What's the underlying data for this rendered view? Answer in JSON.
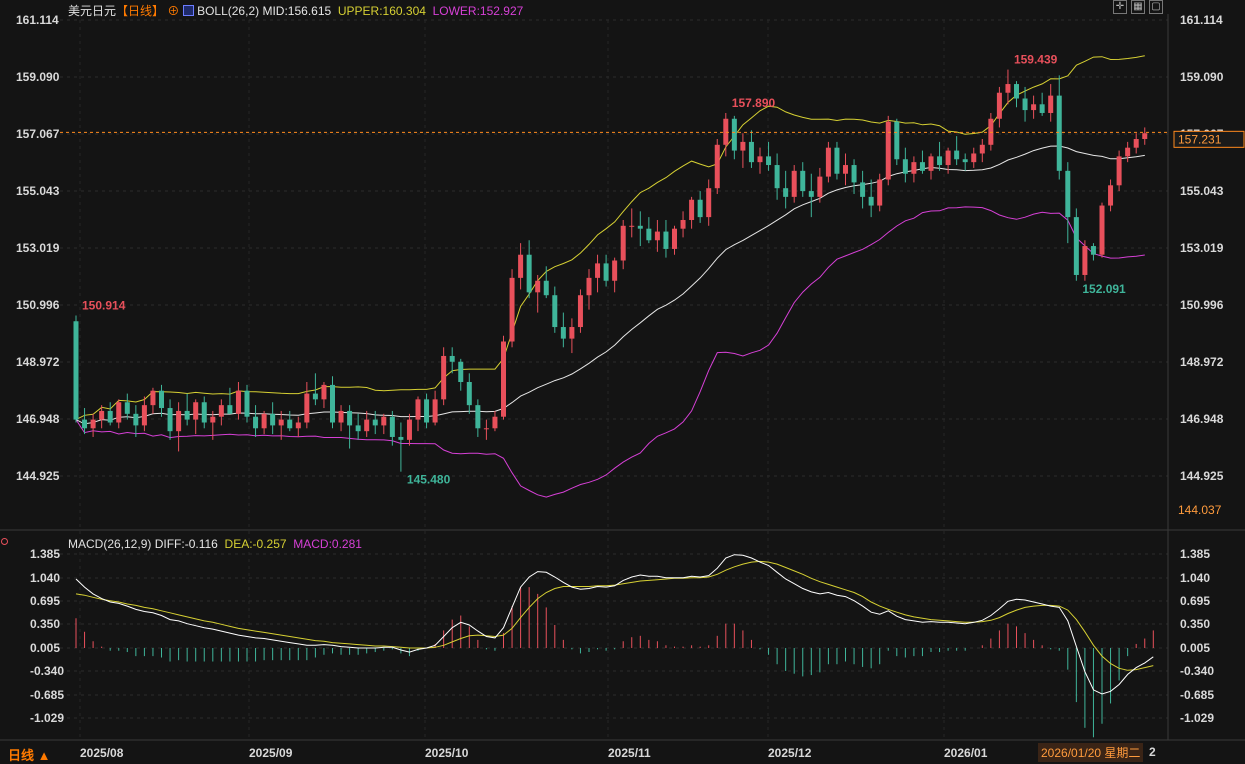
{
  "header": {
    "title": "美元日元",
    "period_tag": "【日线】",
    "boll_label": "BOLL(26,2)",
    "mid": "MID:156.615",
    "upper": "UPPER:160.304",
    "lower": "LOWER:152.927"
  },
  "macd_header": {
    "label": "MACD(26,12,9)",
    "diff": "DIFF:-0.116",
    "dea": "DEA:-0.257",
    "macd": "MACD:0.281"
  },
  "footer": {
    "period": "日线 ▲",
    "timestamp": "2026/01/20 星期二",
    "timestamp_tail": "2"
  },
  "price_axis": {
    "ticks": [
      "161.114",
      "159.090",
      "157.067",
      "155.043",
      "153.019",
      "150.996",
      "148.972",
      "146.948",
      "144.925"
    ],
    "current_price": "157.231",
    "low_marker": "144.037"
  },
  "macd_axis": {
    "ticks": [
      "1.385",
      "1.040",
      "0.695",
      "0.350",
      "0.005",
      "-0.340",
      "-0.685",
      "-1.029"
    ]
  },
  "colors": {
    "up": "#e8505b",
    "down": "#3fb59a",
    "mid": "#e6e6e6",
    "upper": "#d6d033",
    "lower": "#d640d6",
    "dea": "#d6d033",
    "diff": "#ffffff"
  },
  "chart_data": [
    {
      "type": "candlestick",
      "xlabel": "",
      "ylabel": "",
      "ylim": [
        144.037,
        161.114
      ],
      "x_tick_labels": [
        "2025/08",
        "2025/09",
        "2025/10",
        "2025/11",
        "2025/12",
        "2026/01"
      ],
      "annotations": [
        {
          "text": "150.914",
          "kind": "high"
        },
        {
          "text": "145.480",
          "kind": "low"
        },
        {
          "text": "157.890",
          "kind": "high"
        },
        {
          "text": "159.439",
          "kind": "high"
        },
        {
          "text": "152.091",
          "kind": "low"
        }
      ],
      "ohlc": [
        [
          150.7,
          150.9,
          147.2,
          147.3
        ],
        [
          147.3,
          147.7,
          146.8,
          147.0
        ],
        [
          147.0,
          147.5,
          146.7,
          147.3
        ],
        [
          147.3,
          147.8,
          147.0,
          147.6
        ],
        [
          147.6,
          147.9,
          147.1,
          147.2
        ],
        [
          147.2,
          148.0,
          147.0,
          147.9
        ],
        [
          147.9,
          148.2,
          147.3,
          147.5
        ],
        [
          147.5,
          147.8,
          146.7,
          147.1
        ],
        [
          147.1,
          148.1,
          146.9,
          147.8
        ],
        [
          147.8,
          148.4,
          147.5,
          148.3
        ],
        [
          148.3,
          148.5,
          147.4,
          147.7
        ],
        [
          147.7,
          148.0,
          146.6,
          146.9
        ],
        [
          146.9,
          147.9,
          146.2,
          147.6
        ],
        [
          147.6,
          148.2,
          147.1,
          147.3
        ],
        [
          147.3,
          148.0,
          146.8,
          147.9
        ],
        [
          147.9,
          148.1,
          147.0,
          147.2
        ],
        [
          147.2,
          147.6,
          146.6,
          147.4
        ],
        [
          147.4,
          148.0,
          147.1,
          147.8
        ],
        [
          147.8,
          148.4,
          147.5,
          147.5
        ],
        [
          147.5,
          148.6,
          147.3,
          148.3
        ],
        [
          148.3,
          148.5,
          147.2,
          147.4
        ],
        [
          147.4,
          147.8,
          146.7,
          147.0
        ],
        [
          147.0,
          147.6,
          146.8,
          147.5
        ],
        [
          147.5,
          147.9,
          146.8,
          147.1
        ],
        [
          147.1,
          147.6,
          146.6,
          147.3
        ],
        [
          147.3,
          147.6,
          146.9,
          147.0
        ],
        [
          147.0,
          147.4,
          146.7,
          147.2
        ],
        [
          147.2,
          148.6,
          147.0,
          148.2
        ],
        [
          148.2,
          148.9,
          147.8,
          148.0
        ],
        [
          148.0,
          148.6,
          147.7,
          148.5
        ],
        [
          148.5,
          148.8,
          147.0,
          147.2
        ],
        [
          147.2,
          147.8,
          146.9,
          147.6
        ],
        [
          147.6,
          147.8,
          146.3,
          147.1
        ],
        [
          147.1,
          147.5,
          146.6,
          146.9
        ],
        [
          146.9,
          147.6,
          146.7,
          147.3
        ],
        [
          147.3,
          147.6,
          146.8,
          147.1
        ],
        [
          147.1,
          147.5,
          146.8,
          147.4
        ],
        [
          147.4,
          147.6,
          146.4,
          146.7
        ],
        [
          146.7,
          147.2,
          145.5,
          146.6
        ],
        [
          146.6,
          147.5,
          146.4,
          147.3
        ],
        [
          147.3,
          148.1,
          146.9,
          148.0
        ],
        [
          148.0,
          148.2,
          147.0,
          147.2
        ],
        [
          147.2,
          148.3,
          147.1,
          148.0
        ],
        [
          148.0,
          149.8,
          147.8,
          149.5
        ],
        [
          149.5,
          149.8,
          148.9,
          149.3
        ],
        [
          149.3,
          149.4,
          148.3,
          148.6
        ],
        [
          148.6,
          148.9,
          147.5,
          147.8
        ],
        [
          147.8,
          148.0,
          146.7,
          147.0
        ],
        [
          147.0,
          147.3,
          146.6,
          147.0
        ],
        [
          147.0,
          147.6,
          146.9,
          147.4
        ],
        [
          147.4,
          150.2,
          147.3,
          150.0
        ],
        [
          150.0,
          152.5,
          149.8,
          152.2
        ],
        [
          152.2,
          153.4,
          151.8,
          153.0
        ],
        [
          153.0,
          153.5,
          151.5,
          151.7
        ],
        [
          151.7,
          152.3,
          151.0,
          152.1
        ],
        [
          152.1,
          152.6,
          151.5,
          151.6
        ],
        [
          151.6,
          151.9,
          150.3,
          150.5
        ],
        [
          150.5,
          151.0,
          149.8,
          150.1
        ],
        [
          150.1,
          150.8,
          149.6,
          150.5
        ],
        [
          150.5,
          151.8,
          150.3,
          151.6
        ],
        [
          151.6,
          152.5,
          151.1,
          152.2
        ],
        [
          152.2,
          153.0,
          151.7,
          152.7
        ],
        [
          152.7,
          153.0,
          151.9,
          152.1
        ],
        [
          152.1,
          152.9,
          151.7,
          152.8
        ],
        [
          152.8,
          154.2,
          152.5,
          154.0
        ],
        [
          154.0,
          154.6,
          153.6,
          154.0
        ],
        [
          154.0,
          154.5,
          153.3,
          153.9
        ],
        [
          153.9,
          154.3,
          153.4,
          153.5
        ],
        [
          153.5,
          154.2,
          153.1,
          153.8
        ],
        [
          153.8,
          154.2,
          152.9,
          153.2
        ],
        [
          153.2,
          154.0,
          153.0,
          153.9
        ],
        [
          153.9,
          154.5,
          153.6,
          154.2
        ],
        [
          154.2,
          155.0,
          153.9,
          154.9
        ],
        [
          154.9,
          155.2,
          154.1,
          154.3
        ],
        [
          154.3,
          155.6,
          154.0,
          155.3
        ],
        [
          155.3,
          157.0,
          155.1,
          156.8
        ],
        [
          156.8,
          157.9,
          156.4,
          157.7
        ],
        [
          157.7,
          157.8,
          156.3,
          156.6
        ],
        [
          156.6,
          157.2,
          156.0,
          156.9
        ],
        [
          156.9,
          157.3,
          156.0,
          156.2
        ],
        [
          156.2,
          156.7,
          155.8,
          156.4
        ],
        [
          156.4,
          156.9,
          155.9,
          156.1
        ],
        [
          156.1,
          156.5,
          154.9,
          155.3
        ],
        [
          155.3,
          155.9,
          154.6,
          155.0
        ],
        [
          155.0,
          156.1,
          154.8,
          155.9
        ],
        [
          155.9,
          156.2,
          155.0,
          155.2
        ],
        [
          155.2,
          155.8,
          154.3,
          155.0
        ],
        [
          155.0,
          156.0,
          154.8,
          155.7
        ],
        [
          155.7,
          156.9,
          155.5,
          156.7
        ],
        [
          156.7,
          156.9,
          155.6,
          155.8
        ],
        [
          155.8,
          156.5,
          155.4,
          156.1
        ],
        [
          156.1,
          156.3,
          155.1,
          155.5
        ],
        [
          155.5,
          155.9,
          154.6,
          155.0
        ],
        [
          155.0,
          155.6,
          154.3,
          154.7
        ],
        [
          154.7,
          155.8,
          154.5,
          155.6
        ],
        [
          155.6,
          157.8,
          155.4,
          157.6
        ],
        [
          157.6,
          157.7,
          156.1,
          156.3
        ],
        [
          156.3,
          156.7,
          155.5,
          155.8
        ],
        [
          155.8,
          156.4,
          155.5,
          156.2
        ],
        [
          156.2,
          156.6,
          155.8,
          155.9
        ],
        [
          155.9,
          156.5,
          155.6,
          156.4
        ],
        [
          156.4,
          156.9,
          155.9,
          156.1
        ],
        [
          156.1,
          156.7,
          155.8,
          156.6
        ],
        [
          156.6,
          157.1,
          156.1,
          156.3
        ],
        [
          156.3,
          156.5,
          155.9,
          156.2
        ],
        [
          156.2,
          156.7,
          156.0,
          156.5
        ],
        [
          156.5,
          157.0,
          156.2,
          156.8
        ],
        [
          156.8,
          157.9,
          156.6,
          157.7
        ],
        [
          157.7,
          158.8,
          157.4,
          158.6
        ],
        [
          158.6,
          159.4,
          158.2,
          158.9
        ],
        [
          158.9,
          159.0,
          158.1,
          158.4
        ],
        [
          158.4,
          158.8,
          157.6,
          158.0
        ],
        [
          158.0,
          158.5,
          157.7,
          158.2
        ],
        [
          158.2,
          158.6,
          157.8,
          157.9
        ],
        [
          157.9,
          158.9,
          157.6,
          158.5
        ],
        [
          158.5,
          159.2,
          155.6,
          155.9
        ],
        [
          155.9,
          156.2,
          153.4,
          154.3
        ],
        [
          154.3,
          154.6,
          152.1,
          152.3
        ],
        [
          152.3,
          153.5,
          152.1,
          153.3
        ],
        [
          153.3,
          153.4,
          152.8,
          153.0
        ],
        [
          153.0,
          154.8,
          152.9,
          154.7
        ],
        [
          154.7,
          155.6,
          154.5,
          155.4
        ],
        [
          155.4,
          156.6,
          155.2,
          156.4
        ],
        [
          156.4,
          156.9,
          156.2,
          156.7
        ],
        [
          156.7,
          157.2,
          156.5,
          157.0
        ],
        [
          157.0,
          157.4,
          156.8,
          157.2
        ]
      ]
    },
    {
      "type": "line",
      "ylim": [
        -1.2,
        1.45
      ],
      "series": [
        {
          "name": "DIFF",
          "values": [
            1.02,
            0.9,
            0.8,
            0.73,
            0.68,
            0.66,
            0.62,
            0.57,
            0.54,
            0.52,
            0.48,
            0.42,
            0.4,
            0.36,
            0.33,
            0.3,
            0.28,
            0.25,
            0.22,
            0.19,
            0.17,
            0.15,
            0.14,
            0.12,
            0.1,
            0.08,
            0.06,
            0.04,
            0.04,
            0.05,
            0.04,
            0.02,
            0.01,
            0.0,
            0.0,
            0.0,
            0.01,
            0.01,
            -0.03,
            -0.06,
            -0.02,
            0.0,
            0.04,
            0.17,
            0.3,
            0.38,
            0.34,
            0.25,
            0.17,
            0.15,
            0.3,
            0.6,
            0.9,
            1.05,
            1.13,
            1.12,
            1.05,
            0.97,
            0.9,
            0.87,
            0.88,
            0.91,
            0.9,
            0.92,
            1.0,
            1.05,
            1.08,
            1.06,
            1.06,
            1.04,
            1.04,
            1.04,
            1.06,
            1.05,
            1.07,
            1.18,
            1.33,
            1.38,
            1.37,
            1.33,
            1.27,
            1.22,
            1.12,
            1.02,
            0.95,
            0.88,
            0.83,
            0.8,
            0.82,
            0.78,
            0.76,
            0.7,
            0.62,
            0.53,
            0.5,
            0.55,
            0.47,
            0.42,
            0.4,
            0.38,
            0.39,
            0.38,
            0.38,
            0.37,
            0.36,
            0.38,
            0.41,
            0.48,
            0.58,
            0.69,
            0.72,
            0.71,
            0.68,
            0.65,
            0.62,
            0.6,
            0.4,
            0.02,
            -0.35,
            -0.62,
            -0.68,
            -0.64,
            -0.54,
            -0.39,
            -0.29,
            -0.22,
            -0.13
          ]
        },
        {
          "name": "DEA",
          "values": [
            0.8,
            0.78,
            0.75,
            0.72,
            0.7,
            0.68,
            0.65,
            0.63,
            0.6,
            0.58,
            0.55,
            0.52,
            0.49,
            0.46,
            0.43,
            0.4,
            0.38,
            0.35,
            0.32,
            0.29,
            0.27,
            0.25,
            0.23,
            0.21,
            0.19,
            0.17,
            0.15,
            0.13,
            0.11,
            0.1,
            0.08,
            0.07,
            0.06,
            0.05,
            0.04,
            0.03,
            0.03,
            0.02,
            0.01,
            0.0,
            0.0,
            0.0,
            0.01,
            0.04,
            0.09,
            0.14,
            0.18,
            0.19,
            0.18,
            0.17,
            0.19,
            0.29,
            0.45,
            0.6,
            0.73,
            0.82,
            0.88,
            0.91,
            0.91,
            0.91,
            0.91,
            0.92,
            0.92,
            0.93,
            0.95,
            0.97,
            0.99,
            1.0,
            1.01,
            1.02,
            1.03,
            1.03,
            1.04,
            1.04,
            1.05,
            1.09,
            1.15,
            1.2,
            1.24,
            1.27,
            1.28,
            1.27,
            1.24,
            1.19,
            1.14,
            1.09,
            1.03,
            0.98,
            0.94,
            0.9,
            0.86,
            0.82,
            0.76,
            0.68,
            0.62,
            0.57,
            0.53,
            0.49,
            0.46,
            0.44,
            0.42,
            0.41,
            0.4,
            0.39,
            0.38,
            0.38,
            0.39,
            0.41,
            0.45,
            0.51,
            0.56,
            0.6,
            0.62,
            0.63,
            0.63,
            0.62,
            0.56,
            0.42,
            0.24,
            0.04,
            -0.12,
            -0.23,
            -0.3,
            -0.33,
            -0.32,
            -0.29,
            -0.26
          ]
        }
      ]
    }
  ]
}
